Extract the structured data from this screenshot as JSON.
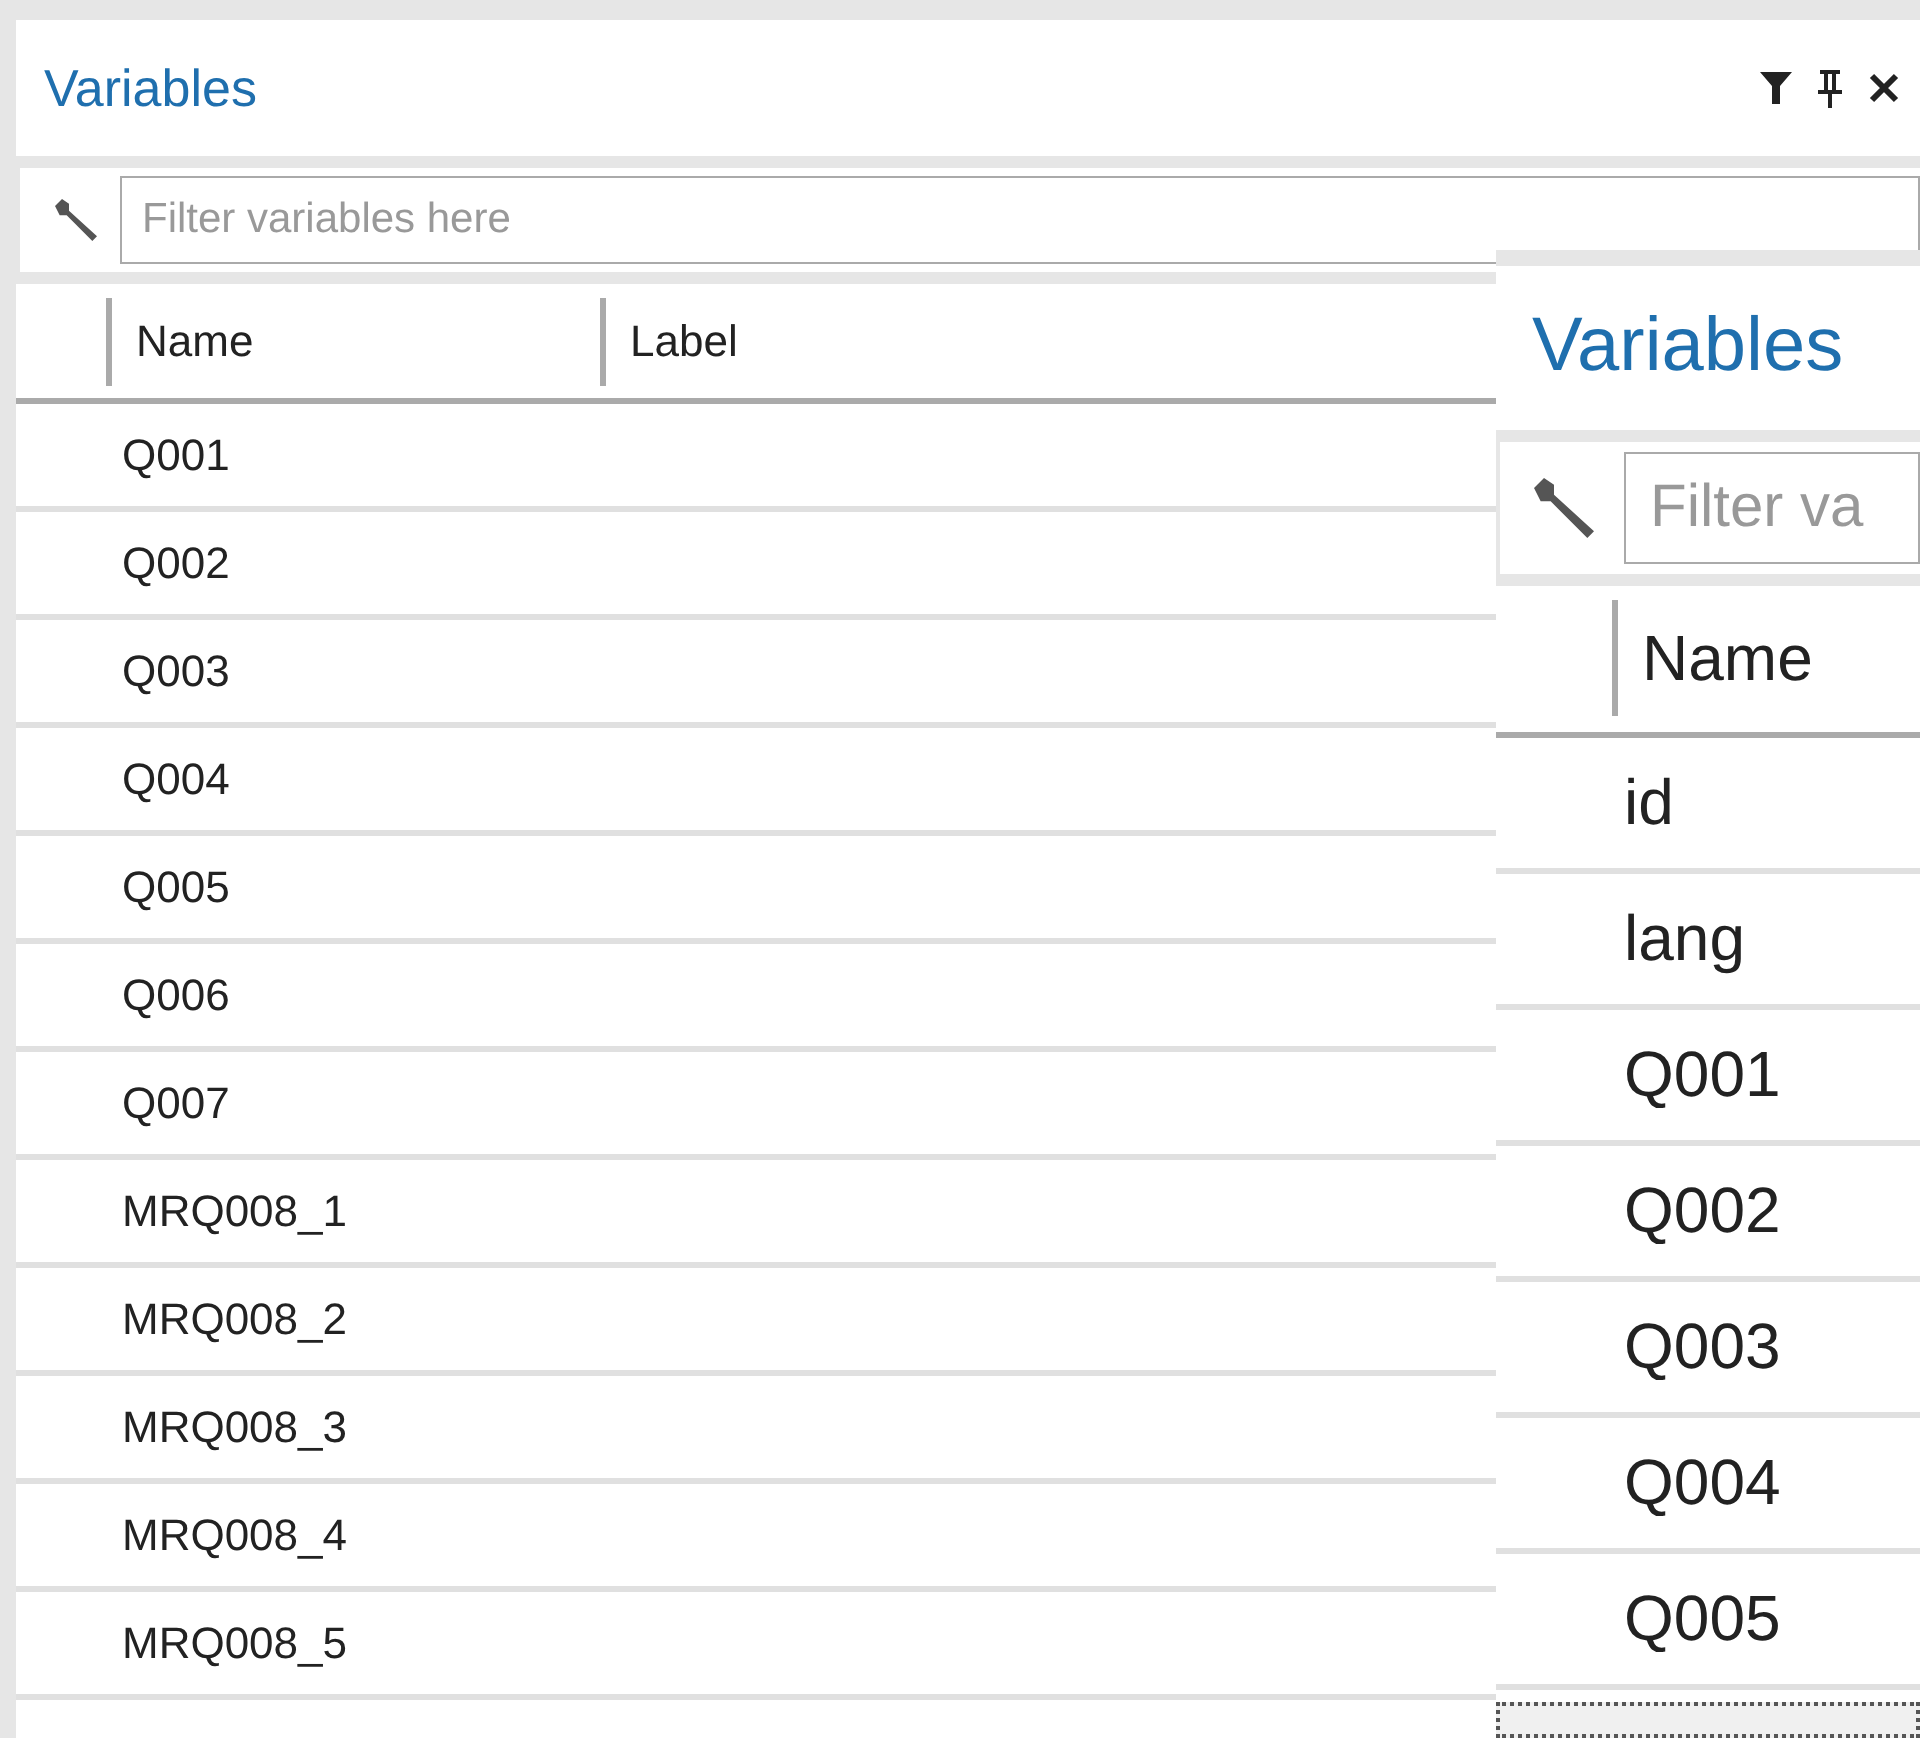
{
  "panels": [
    {
      "kind": "docked",
      "title": "Variables",
      "tool_buttons": [
        {
          "kind": "filter"
        },
        {
          "kind": "pin"
        },
        {
          "kind": "close"
        }
      ],
      "filter": {
        "placeholder": "Filter variables here"
      },
      "columns": [
        "Name",
        "Label"
      ],
      "rows": [
        "Q001",
        "Q002",
        "Q003",
        "Q004",
        "Q005",
        "Q006",
        "Q007",
        "MRQ008_1",
        "MRQ008_2",
        "MRQ008_3",
        "MRQ008_4",
        "MRQ008_5"
      ]
    },
    {
      "kind": "zoomed",
      "title": "Variables",
      "filter": {
        "placeholder": "Filter va"
      },
      "columns": [
        "Name"
      ],
      "rows": [
        "id",
        "lang",
        "Q001",
        "Q002",
        "Q003",
        "Q004",
        "Q005"
      ]
    }
  ]
}
